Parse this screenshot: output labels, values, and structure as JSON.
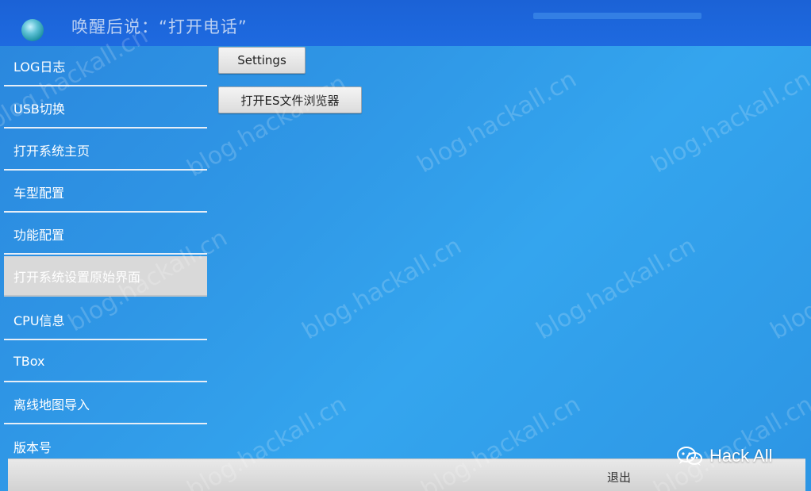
{
  "header": {
    "title": "唤醒后说：“打开电话”"
  },
  "sidebar": {
    "items": [
      {
        "label": "LOG日志"
      },
      {
        "label": "USB切换"
      },
      {
        "label": "打开系统主页"
      },
      {
        "label": "车型配置"
      },
      {
        "label": "功能配置"
      },
      {
        "label": "打开系统设置原始界面",
        "selected": true
      },
      {
        "label": "CPU信息"
      },
      {
        "label": "TBox"
      },
      {
        "label": "离线地图导入"
      },
      {
        "label": "版本号"
      }
    ]
  },
  "main": {
    "buttons": [
      {
        "label": "Settings"
      },
      {
        "label": "打开ES文件浏览器"
      }
    ]
  },
  "bottom": {
    "exit_label": "退出"
  },
  "watermark": {
    "text": "blog.hackall.cn"
  },
  "brand": {
    "label": "Hack All",
    "icon": "wechat-icon"
  },
  "colors": {
    "header_bg": "#1e6ae0",
    "content_bg": "#2f97e6",
    "selected_item_bg": "#d9d9d9",
    "bottom_bar_bg": "#dcdcdc"
  }
}
